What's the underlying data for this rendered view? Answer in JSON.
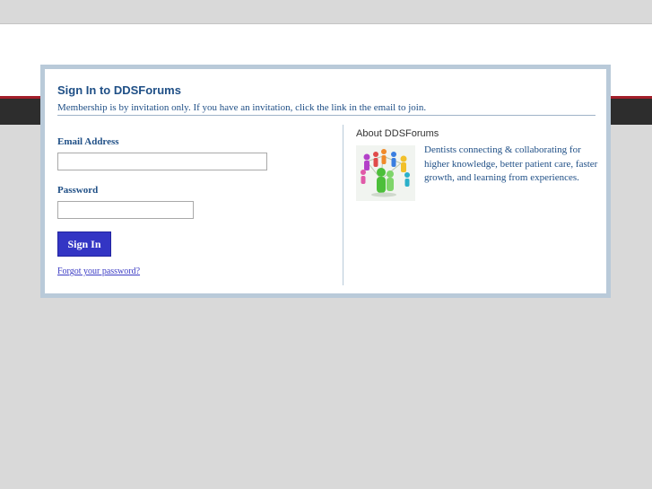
{
  "login": {
    "title": "Sign In to DDSForums",
    "subtitle": "Membership is by invitation only. If you have an invitation, click the link in the email to join.",
    "email_label": "Email Address",
    "email_value": "",
    "password_label": "Password",
    "password_value": "",
    "signin_label": "Sign In",
    "forgot_label": "Forgot your password?"
  },
  "about": {
    "title": "About DDSForums",
    "text": "Dentists connecting & collaborating for higher knowledge, better patient care, faster growth, and learning from experiences.",
    "image_icon": "people-network-icon"
  },
  "colors": {
    "accent_blue": "#1f4f86",
    "button_blue": "#3335c4",
    "frame": "#b9cad9",
    "header_red": "#a31f2a",
    "header_dark": "#2d2d2d"
  }
}
